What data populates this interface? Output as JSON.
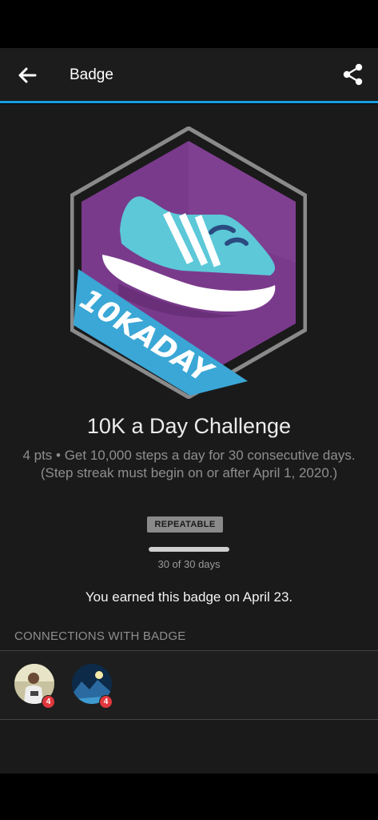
{
  "header": {
    "title": "Badge",
    "back_icon": "arrow-left-icon",
    "share_icon": "share-icon",
    "accent_color": "#1a9ce0"
  },
  "badge": {
    "emblem_text": "10KADAY",
    "emblem_colors": {
      "hex_fill": "#7a3a8c",
      "banner": "#3aa7d6",
      "shoe": "#5cc8d8"
    },
    "name": "10K a Day Challenge",
    "description": "4 pts • Get 10,000 steps a day for 30 consecutive days. (Step streak must begin on or after April 1, 2020.)",
    "chip": "REPEATABLE",
    "progress": {
      "current": 30,
      "total": 30,
      "fraction": 1.0
    },
    "progress_text": "30 of 30 days",
    "earned_text": "You earned this badge on April 23."
  },
  "connections": {
    "header": "CONNECTIONS WITH BADGE",
    "items": [
      {
        "avatar_icon": "user-photo-icon",
        "level": "4"
      },
      {
        "avatar_icon": "landscape-photo-icon",
        "level": "4"
      }
    ]
  }
}
